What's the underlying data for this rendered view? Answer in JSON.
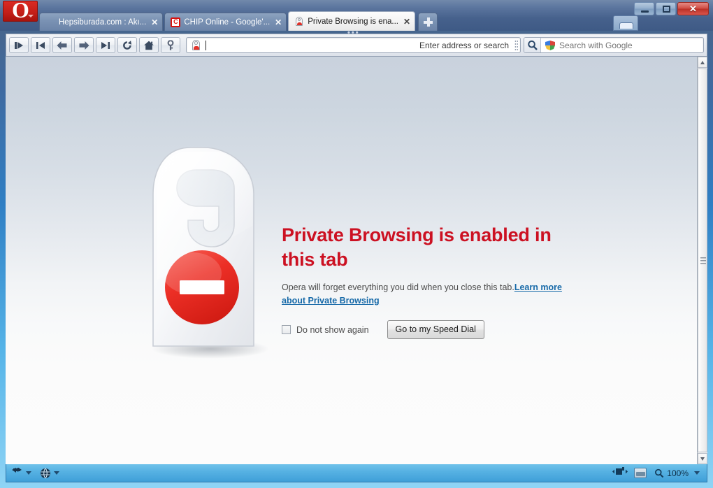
{
  "window": {
    "opera_menu_label": "O",
    "controls": {
      "minimize": "minimize-button",
      "maximize": "maximize-button",
      "close": "close-button"
    },
    "panel_toggle_label": "panel-toggle"
  },
  "tabs": {
    "items": [
      {
        "label": "Hepsiburada.com : Akı...",
        "favicon": "hepsiburada-favicon",
        "active": false,
        "close_label": "✕"
      },
      {
        "label": "CHIP Online - Google'...",
        "favicon": "chip-favicon",
        "active": false,
        "close_label": "✕"
      },
      {
        "label": "Private Browsing is ena...",
        "favicon": "private-browsing-favicon",
        "active": true,
        "close_label": "✕"
      }
    ],
    "new_tab_label": "+",
    "overflow_dots": "•••"
  },
  "toolbar": {
    "buttons": [
      {
        "name": "fast-forward-button",
        "icon": "fast-forward-icon"
      },
      {
        "name": "rewind-button",
        "icon": "rewind-icon"
      },
      {
        "name": "back-button",
        "icon": "arrow-left-icon"
      },
      {
        "name": "forward-button",
        "icon": "arrow-right-icon"
      },
      {
        "name": "fast-forward-end-button",
        "icon": "forward-end-icon"
      },
      {
        "name": "reload-button",
        "icon": "reload-icon"
      },
      {
        "name": "home-button",
        "icon": "home-icon"
      },
      {
        "name": "wand-button",
        "icon": "key-icon"
      }
    ],
    "address": {
      "value": "",
      "placeholder": "",
      "hint": "Enter address or search",
      "icon": "private-browsing-icon"
    },
    "search": {
      "value": "",
      "placeholder": "Search with Google",
      "engine": "Google",
      "go_icon": "magnifier-icon"
    }
  },
  "page": {
    "headline": "Private Browsing is enabled in this tab",
    "body_prefix": "Opera will forget everything you did when you close this tab.",
    "link_text": "Learn more about Private Browsing",
    "checkbox_label": "Do not show again",
    "checkbox_checked": false,
    "button_label": "Go to my Speed Dial",
    "illustration": "door-hanger-no-entry"
  },
  "statusbar": {
    "left_items": [
      {
        "name": "transfers-icon",
        "label": ""
      },
      {
        "name": "globe-icon",
        "label": ""
      }
    ],
    "zoom": "100%",
    "images_toggle": "images-toggle",
    "content_blocker": "content-blocker-icon"
  },
  "scrollbar": {
    "up_arrow": "scroll-up-arrow",
    "down_arrow": "scroll-down-arrow",
    "thumb": "scroll-thumb"
  },
  "colors": {
    "accent_red": "#cc1122",
    "link_blue": "#1669a8",
    "titlebar_blue": "#46618c",
    "status_blue": "#57b2e3"
  }
}
